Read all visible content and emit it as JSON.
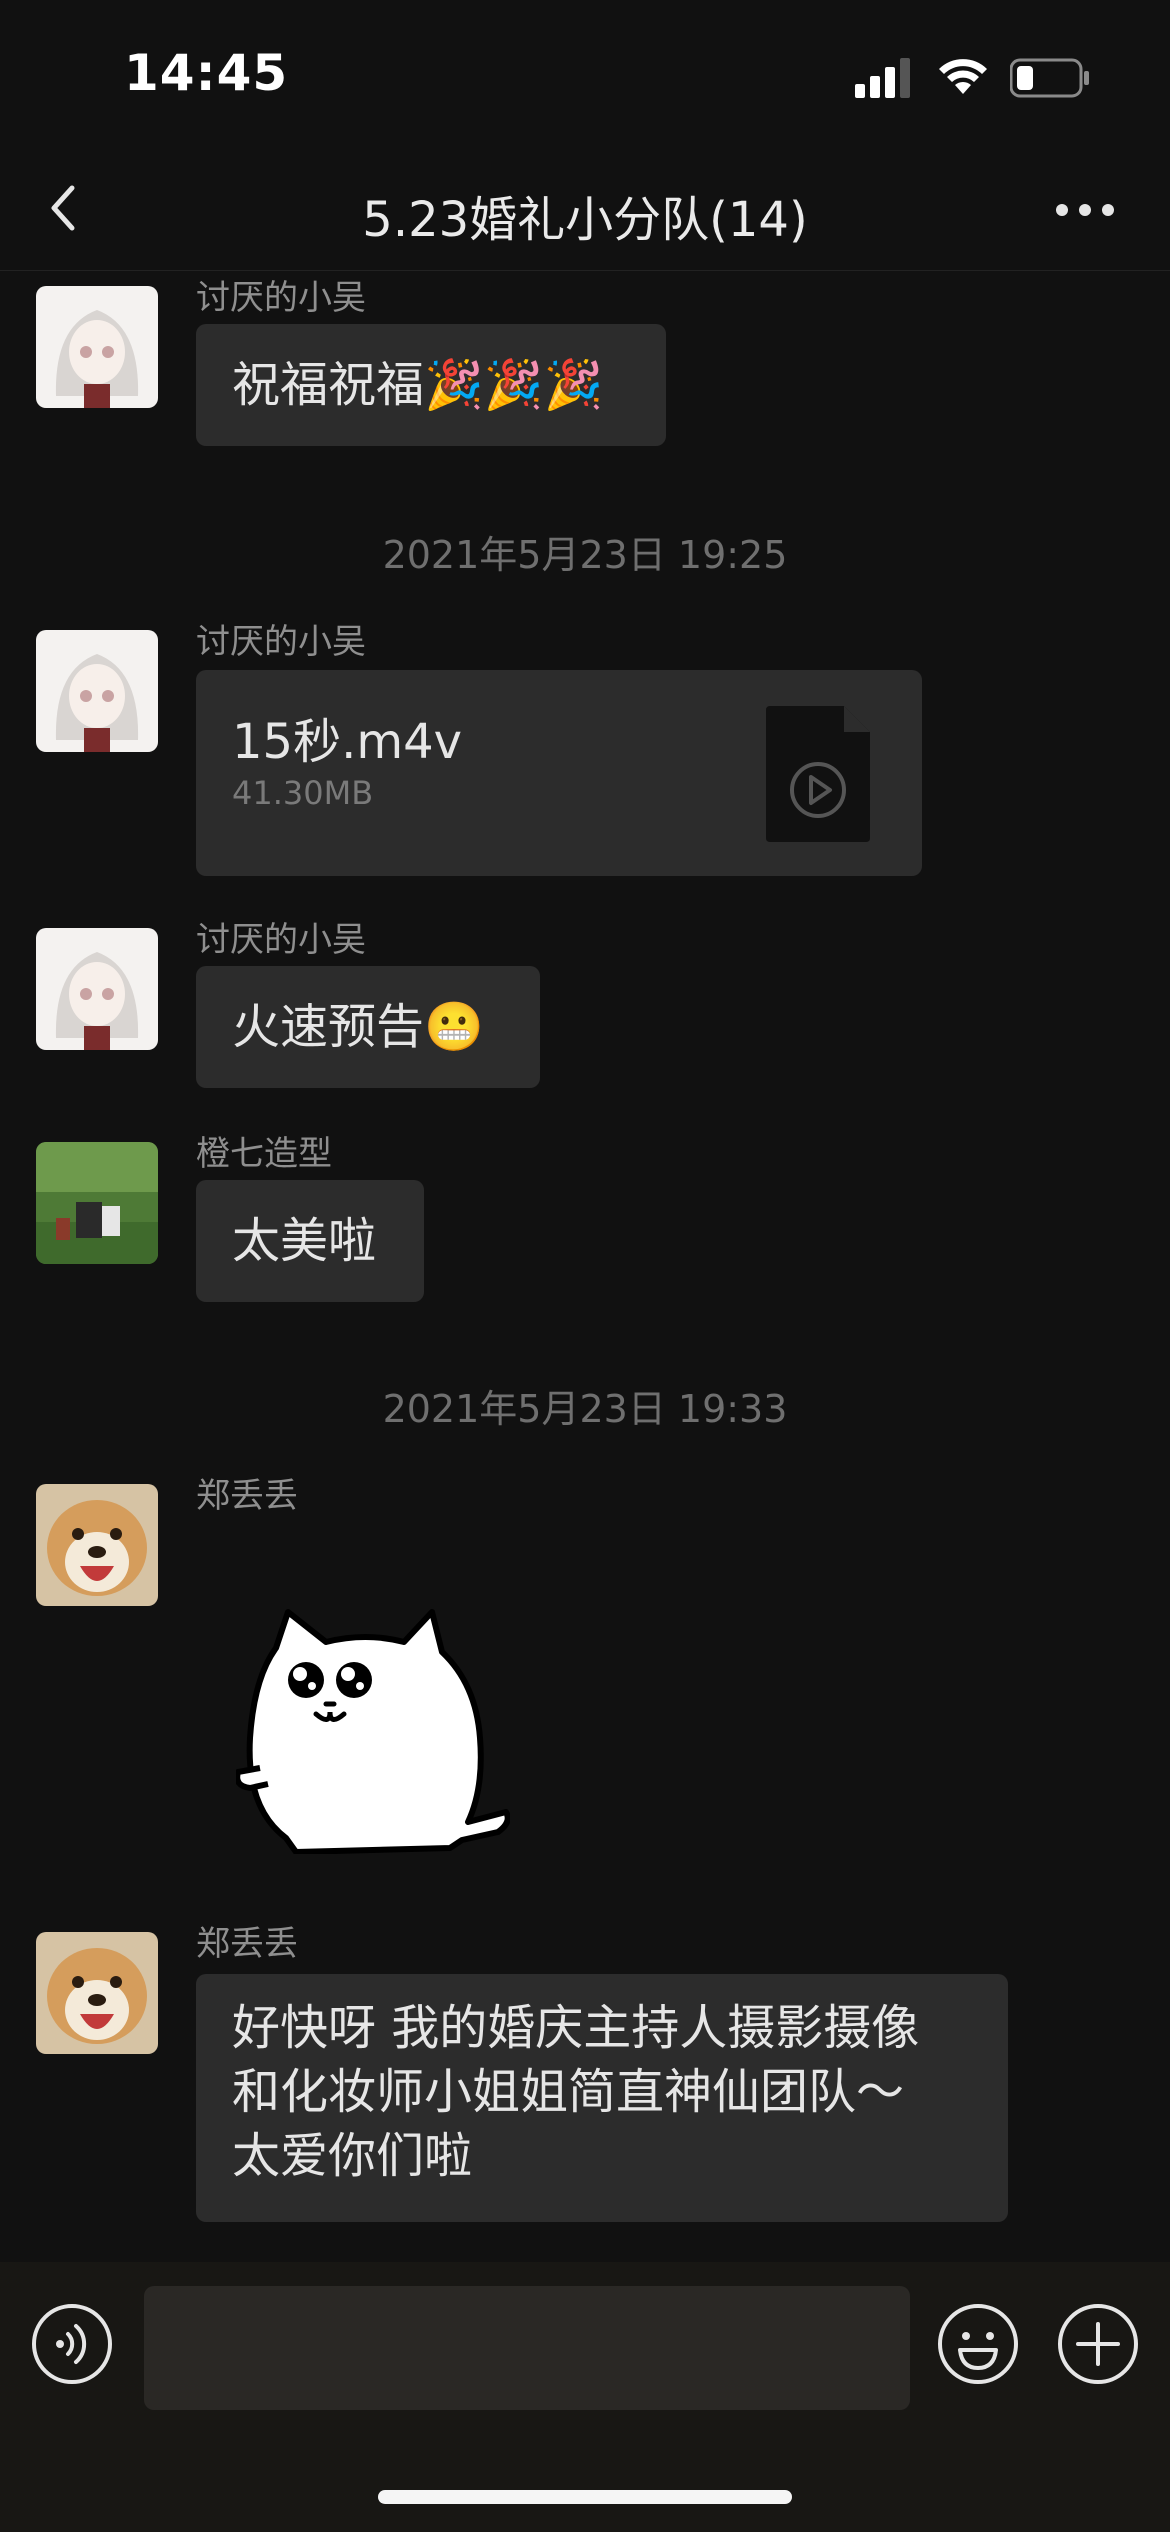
{
  "status_bar": {
    "time": "14:45"
  },
  "nav": {
    "title": "5.23婚礼小分队(14)"
  },
  "messages": [
    {
      "sender": "讨厌的小吴",
      "text": "祝福祝福🎉🎉🎉"
    },
    {
      "timestamp": "2021年5月23日 19:25"
    },
    {
      "sender": "讨厌的小吴",
      "file_name": "15秒.m4v",
      "file_size": "41.30MB"
    },
    {
      "sender": "讨厌的小吴",
      "text": "火速预告😬"
    },
    {
      "sender": "橙七造型",
      "text": "太美啦"
    },
    {
      "timestamp": "2021年5月23日 19:33"
    },
    {
      "sender": "郑丢丢",
      "sticker": "cat-sticker"
    },
    {
      "sender": "郑丢丢",
      "text_lines": [
        "好快呀 我的婚庆主持人摄影摄像",
        "和化妆师小姐姐简直神仙团队～",
        "太爱你们啦"
      ]
    }
  ],
  "input": {
    "placeholder": ""
  },
  "icons": {
    "back": "back-chevron-icon",
    "more": "more-dots-icon",
    "voice": "voice-icon",
    "emoji": "emoji-icon",
    "plus": "plus-icon"
  }
}
